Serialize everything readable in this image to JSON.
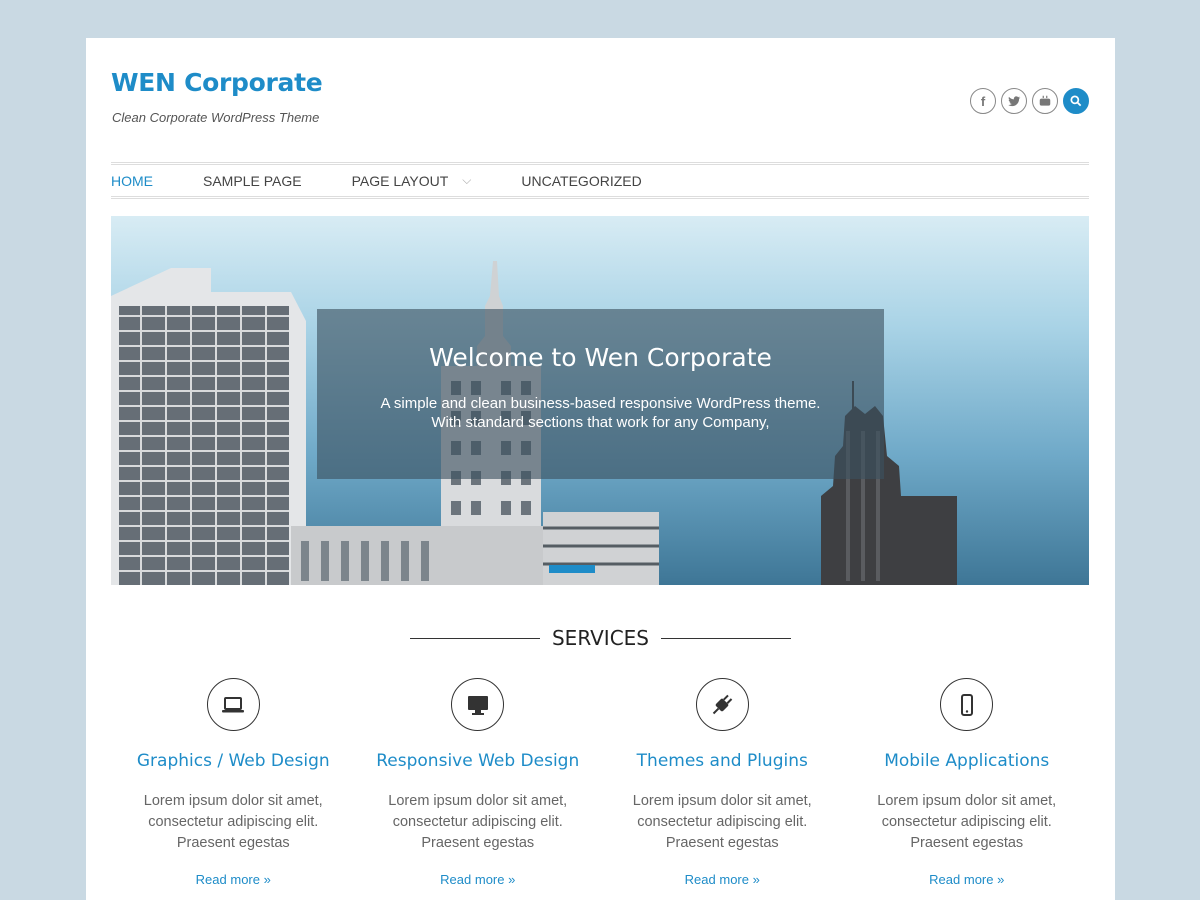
{
  "site": {
    "title": "WEN Corporate",
    "tagline": "Clean Corporate WordPress Theme"
  },
  "social": [
    {
      "icon": "facebook-icon",
      "glyph": "f"
    },
    {
      "icon": "twitter-icon",
      "glyph": ""
    },
    {
      "icon": "youtube-icon",
      "glyph": ""
    },
    {
      "icon": "search-icon",
      "glyph": ""
    }
  ],
  "nav": {
    "items": [
      {
        "label": "HOME",
        "active": true
      },
      {
        "label": "SAMPLE PAGE",
        "active": false
      },
      {
        "label": "PAGE LAYOUT",
        "active": false,
        "has_submenu": true
      },
      {
        "label": "UNCATEGORIZED",
        "active": false
      }
    ]
  },
  "hero": {
    "heading": "Welcome to Wen Corporate",
    "line1": "A simple and clean business-based responsive WordPress theme.",
    "line2": "With standard sections that work for any Company,"
  },
  "services": {
    "heading": "SERVICES",
    "items": [
      {
        "title": "Graphics / Web Design",
        "icon": "laptop-icon",
        "text1": "Lorem ipsum dolor sit amet,",
        "text2": "consectetur adipiscing elit.",
        "text3": "Praesent egestas",
        "more": "Read more »"
      },
      {
        "title": "Responsive Web Design",
        "icon": "monitor-icon",
        "text1": "Lorem ipsum dolor sit amet,",
        "text2": "consectetur adipiscing elit.",
        "text3": "Praesent egestas",
        "more": "Read more »"
      },
      {
        "title": "Themes and Plugins",
        "icon": "plug-icon",
        "text1": "Lorem ipsum dolor sit amet,",
        "text2": "consectetur adipiscing elit.",
        "text3": "Praesent egestas",
        "more": "Read more »"
      },
      {
        "title": "Mobile Applications",
        "icon": "mobile-icon",
        "text1": "Lorem ipsum dolor sit amet,",
        "text2": "consectetur adipiscing elit.",
        "text3": "Praesent egestas",
        "more": "Read more »"
      }
    ]
  },
  "colors": {
    "accent": "#1e8cc8",
    "background": "#c9d9e3"
  }
}
